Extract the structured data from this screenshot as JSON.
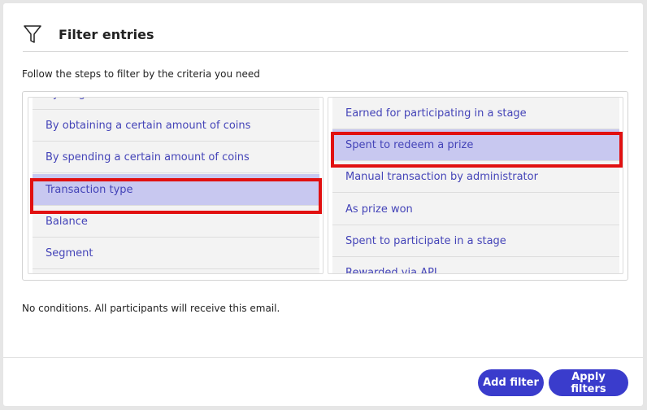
{
  "header": {
    "title": "Filter entries",
    "icon": "filter-icon"
  },
  "instructions": "Follow the steps to filter by the criteria you need",
  "left_column": {
    "items": [
      {
        "label": "By stage"
      },
      {
        "label": "By obtaining a certain amount of coins"
      },
      {
        "label": "By spending a certain amount of coins"
      },
      {
        "label": "Transaction type",
        "selected": true
      },
      {
        "label": "Balance"
      },
      {
        "label": "Segment"
      }
    ]
  },
  "right_column": {
    "items": [
      {
        "label": "Earned for participating in a stage"
      },
      {
        "label": "Spent to redeem a prize",
        "selected": true
      },
      {
        "label": "Manual transaction by administrator"
      },
      {
        "label": "As prize won"
      },
      {
        "label": "Spent to participate in a stage"
      },
      {
        "label": "Rewarded via API"
      }
    ]
  },
  "status": "No conditions. All participants will receive this email.",
  "buttons": {
    "add_filter": "Add filter",
    "apply_filters": "Apply filters"
  },
  "colors": {
    "accent": "#3a3ccc",
    "selected_bg": "#c8c8f0",
    "link_text": "#4444b8",
    "highlight": "#e11010"
  }
}
